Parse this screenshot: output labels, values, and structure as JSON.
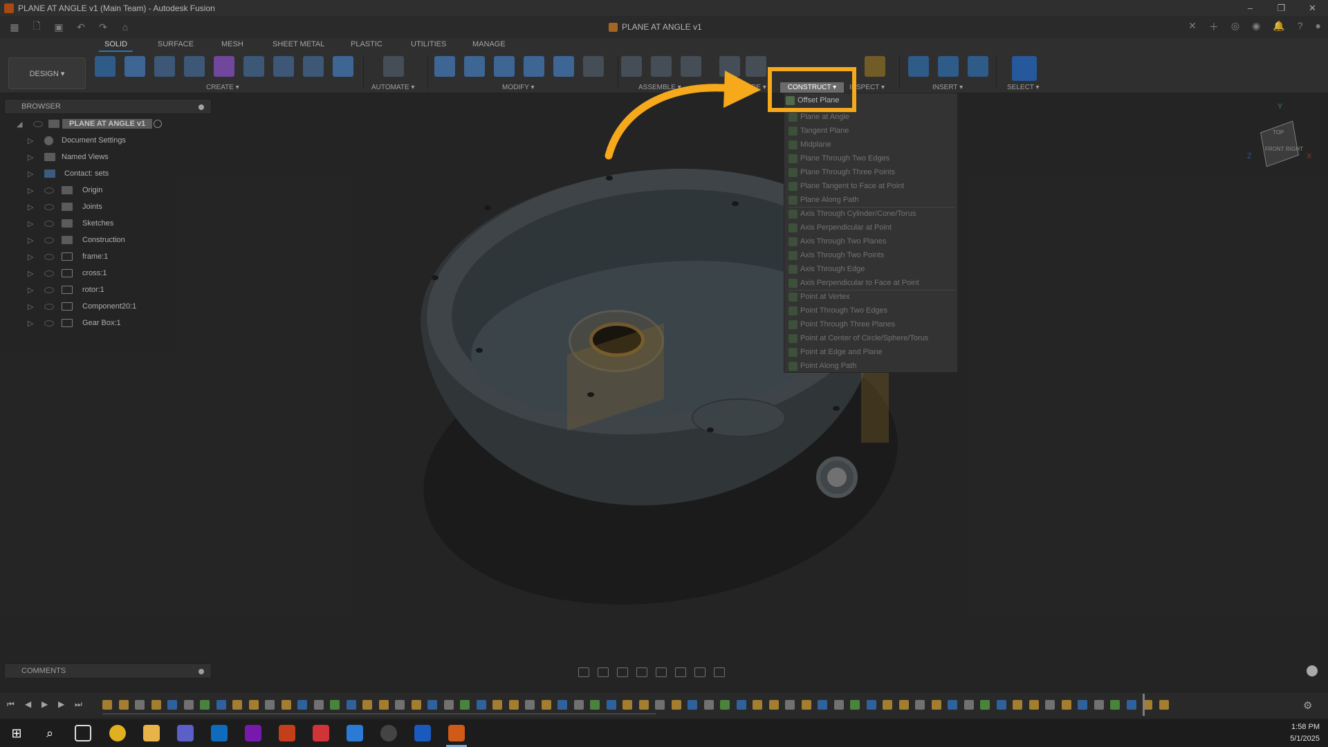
{
  "window": {
    "title": "PLANE AT ANGLE v1 (Main Team) - Autodesk Fusion",
    "controls": [
      "–",
      "❐",
      "✕"
    ]
  },
  "document": {
    "tab_title": "PLANE AT ANGLE v1"
  },
  "ribbon": {
    "tabs": [
      "SOLID",
      "SURFACE",
      "MESH",
      "SHEET METAL",
      "PLASTIC",
      "UTILITIES",
      "MANAGE"
    ],
    "active_tab": "SOLID",
    "workspace": "DESIGN ▾",
    "groups": {
      "create": "CREATE ▾",
      "automate": "AUTOMATE ▾",
      "modify": "MODIFY ▾",
      "assemble": "ASSEMBLE ▾",
      "configure": "CONFIGURE ▾",
      "construct": "CONSTRUCT ▾",
      "inspect": "INSPECT ▾",
      "insert": "INSERT ▾",
      "select": "SELECT ▾"
    }
  },
  "browser": {
    "header": "BROWSER",
    "root": "PLANE AT ANGLE v1",
    "items": [
      {
        "label": "Document Settings"
      },
      {
        "label": "Named Views"
      },
      {
        "label": "Contact: sets"
      },
      {
        "label": "Origin"
      },
      {
        "label": "Joints"
      },
      {
        "label": "Sketches"
      },
      {
        "label": "Construction"
      },
      {
        "label": "frame:1"
      },
      {
        "label": "cross:1"
      },
      {
        "label": "rotor:1"
      },
      {
        "label": "Component20:1"
      },
      {
        "label": "Gear Box:1"
      }
    ]
  },
  "construct_menu": {
    "button": "CONSTRUCT ▾",
    "highlighted": "Offset Plane",
    "items": [
      "Plane at Angle",
      "Tangent Plane",
      "Midplane",
      "Plane Through Two Edges",
      "Plane Through Three Points",
      "Plane Tangent to Face at Point",
      "Plane Along Path",
      "Axis Through Cylinder/Cone/Torus",
      "Axis Perpendicular at Point",
      "Axis Through Two Planes",
      "Axis Through Two Points",
      "Axis Through Edge",
      "Axis Perpendicular to Face at Point",
      "Point at Vertex",
      "Point Through Two Edges",
      "Point Through Three Planes",
      "Point at Center of Circle/Sphere/Torus",
      "Point at Edge and Plane",
      "Point Along Path"
    ]
  },
  "viewcube": {
    "top": "TOP",
    "front": "FRONT",
    "right": "RIGHT",
    "x": "X",
    "y": "Y",
    "z": "Z"
  },
  "comments": {
    "header": "COMMENTS"
  },
  "taskbar": {
    "time": "1:58 PM",
    "date": "5/1/2025"
  },
  "colors": {
    "accent": "#f5a91b",
    "app_orange": "#d05a17",
    "active_tab": "#3e8ed0"
  }
}
